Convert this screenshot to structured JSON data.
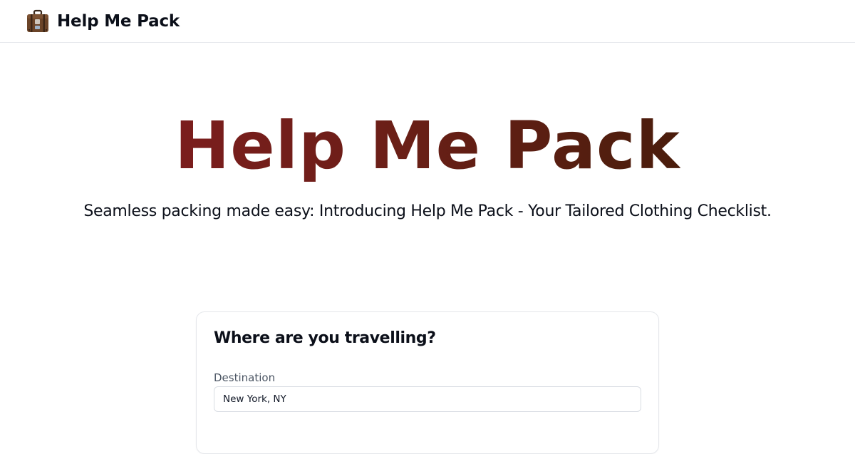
{
  "header": {
    "brand_name": "Help Me Pack",
    "logo_icon": "suitcase-icon"
  },
  "hero": {
    "title": "Help Me Pack",
    "subtitle": "Seamless packing made easy: Introducing Help Me Pack - Your Tailored Clothing Checklist.",
    "gradient_colors": [
      "#7b1d1d",
      "#4a1d0c"
    ]
  },
  "form": {
    "title": "Where are you travelling?",
    "destination": {
      "label": "Destination",
      "value": "New York, NY",
      "placeholder": ""
    }
  }
}
